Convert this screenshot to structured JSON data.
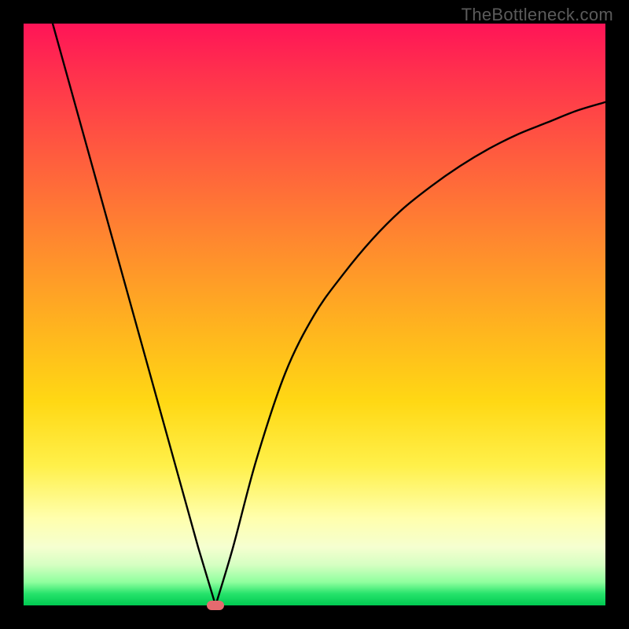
{
  "watermark": "TheBottleneck.com",
  "chart_data": {
    "type": "line",
    "title": "",
    "xlabel": "",
    "ylabel": "",
    "xlim": [
      0,
      100
    ],
    "ylim": [
      0,
      100
    ],
    "grid": false,
    "legend": false,
    "series": [
      {
        "name": "left-branch",
        "x": [
          5,
          10,
          15,
          20,
          25,
          30,
          33
        ],
        "y": [
          100,
          82,
          64,
          46,
          28,
          10,
          0
        ]
      },
      {
        "name": "right-branch",
        "x": [
          33,
          36,
          40,
          45,
          50,
          55,
          60,
          65,
          70,
          75,
          80,
          85,
          90,
          95,
          100
        ],
        "y": [
          0,
          10,
          25,
          40,
          50,
          57,
          63,
          68,
          72,
          75.5,
          78.5,
          81,
          83,
          85,
          86.5
        ]
      }
    ],
    "marker": {
      "x": 33,
      "y": 0
    }
  },
  "colors": {
    "curve": "#000000",
    "marker": "#e66a6f"
  }
}
